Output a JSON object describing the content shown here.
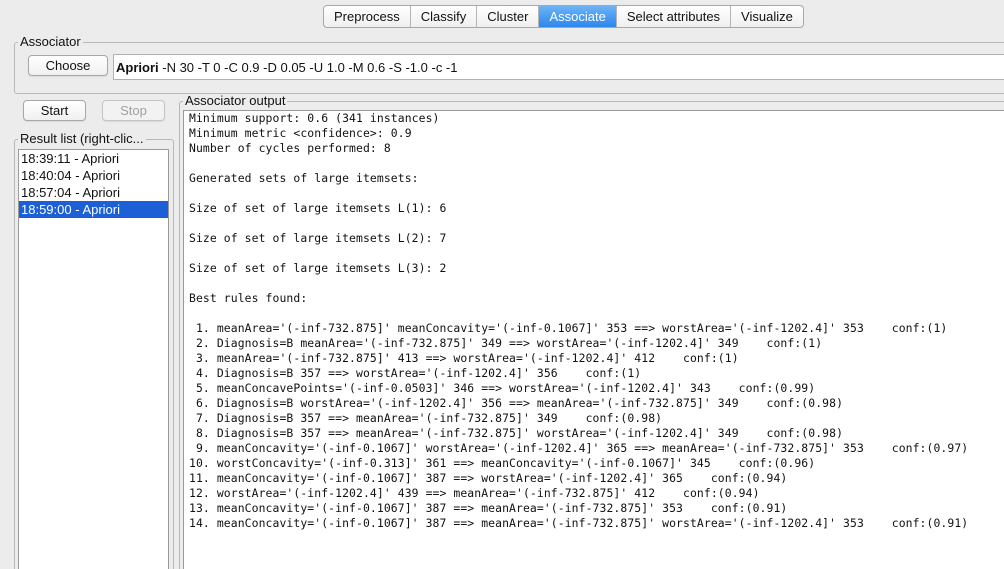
{
  "tabs": [
    {
      "label": "Preprocess"
    },
    {
      "label": "Classify"
    },
    {
      "label": "Cluster"
    },
    {
      "label": "Associate",
      "selected": true
    },
    {
      "label": "Select attributes"
    },
    {
      "label": "Visualize"
    }
  ],
  "associator": {
    "group_label": "Associator",
    "choose_label": "Choose",
    "algorithm": "Apriori",
    "options": "-N 30 -T 0 -C 0.9 -D 0.05 -U 1.0 -M 0.6 -S -1.0 -c -1"
  },
  "controls": {
    "start_label": "Start",
    "stop_label": "Stop"
  },
  "result_list": {
    "label": "Result list (right-clic...",
    "items": [
      {
        "label": "18:39:11 - Apriori"
      },
      {
        "label": "18:40:04 - Apriori"
      },
      {
        "label": "18:57:04 - Apriori"
      },
      {
        "label": "18:59:00 - Apriori",
        "selected": true
      }
    ]
  },
  "output": {
    "label": "Associator output",
    "lines": [
      "Minimum support: 0.6 (341 instances)",
      "Minimum metric <confidence>: 0.9",
      "Number of cycles performed: 8",
      "",
      "Generated sets of large itemsets:",
      "",
      "Size of set of large itemsets L(1): 6",
      "",
      "Size of set of large itemsets L(2): 7",
      "",
      "Size of set of large itemsets L(3): 2",
      "",
      "Best rules found:",
      "",
      " 1. meanArea='(-inf-732.875]' meanConcavity='(-inf-0.1067]' 353 ==> worstArea='(-inf-1202.4]' 353    conf:(1)",
      " 2. Diagnosis=B meanArea='(-inf-732.875]' 349 ==> worstArea='(-inf-1202.4]' 349    conf:(1)",
      " 3. meanArea='(-inf-732.875]' 413 ==> worstArea='(-inf-1202.4]' 412    conf:(1)",
      " 4. Diagnosis=B 357 ==> worstArea='(-inf-1202.4]' 356    conf:(1)",
      " 5. meanConcavePoints='(-inf-0.0503]' 346 ==> worstArea='(-inf-1202.4]' 343    conf:(0.99)",
      " 6. Diagnosis=B worstArea='(-inf-1202.4]' 356 ==> meanArea='(-inf-732.875]' 349    conf:(0.98)",
      " 7. Diagnosis=B 357 ==> meanArea='(-inf-732.875]' 349    conf:(0.98)",
      " 8. Diagnosis=B 357 ==> meanArea='(-inf-732.875]' worstArea='(-inf-1202.4]' 349    conf:(0.98)",
      " 9. meanConcavity='(-inf-0.1067]' worstArea='(-inf-1202.4]' 365 ==> meanArea='(-inf-732.875]' 353    conf:(0.97)",
      "10. worstConcavity='(-inf-0.313]' 361 ==> meanConcavity='(-inf-0.1067]' 345    conf:(0.96)",
      "11. meanConcavity='(-inf-0.1067]' 387 ==> worstArea='(-inf-1202.4]' 365    conf:(0.94)",
      "12. worstArea='(-inf-1202.4]' 439 ==> meanArea='(-inf-732.875]' 412    conf:(0.94)",
      "13. meanConcavity='(-inf-0.1067]' 387 ==> meanArea='(-inf-732.875]' 353    conf:(0.91)",
      "14. meanConcavity='(-inf-0.1067]' 387 ==> meanArea='(-inf-732.875]' worstArea='(-inf-1202.4]' 353    conf:(0.91)"
    ]
  }
}
